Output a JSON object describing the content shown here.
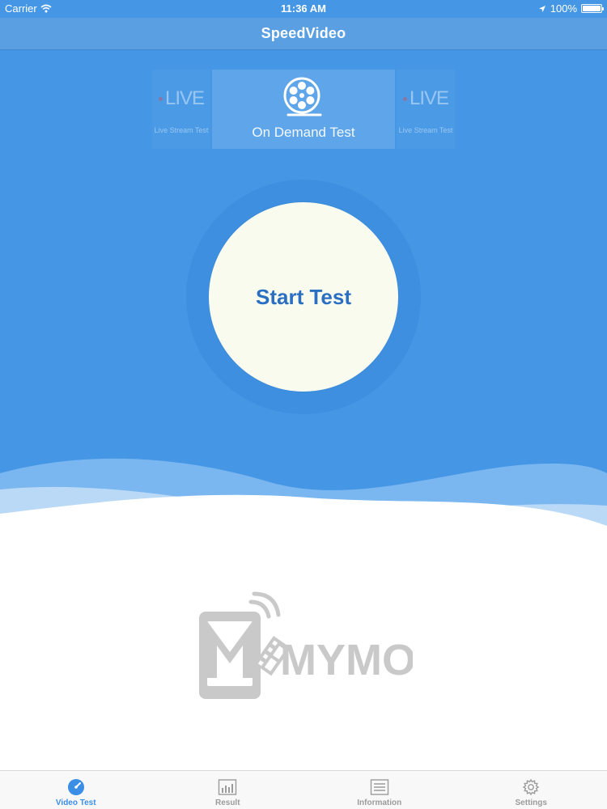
{
  "status_bar": {
    "carrier": "Carrier",
    "time": "11:36 AM",
    "battery": "100%",
    "battery_level": 1.0
  },
  "nav": {
    "title": "SpeedVideo"
  },
  "test_types": {
    "left_badge": "LIVE",
    "left_caption": "Live Stream Test",
    "selected_label": "On Demand Test",
    "right_badge": "LIVE",
    "right_caption": "Live Stream Test",
    "selected_icon": "film-reel-icon"
  },
  "start_button": {
    "label": "Start Test"
  },
  "logo": {
    "text": "MYMOS"
  },
  "tabs": [
    {
      "label": "Video Test",
      "icon": "speedometer-icon",
      "active": true
    },
    {
      "label": "Result",
      "icon": "bar-chart-icon",
      "active": false
    },
    {
      "label": "Information",
      "icon": "list-icon",
      "active": false
    },
    {
      "label": "Settings",
      "icon": "gear-icon",
      "active": false
    }
  ],
  "colors": {
    "primary_blue": "#4597e6",
    "nav_blue": "#5a9fe2",
    "button_fill": "#fafbef",
    "button_text": "#2a6fc2",
    "tab_active": "#3a8ee6",
    "tab_inactive": "#9b9b9b",
    "logo_gray": "#c9c9c9"
  }
}
